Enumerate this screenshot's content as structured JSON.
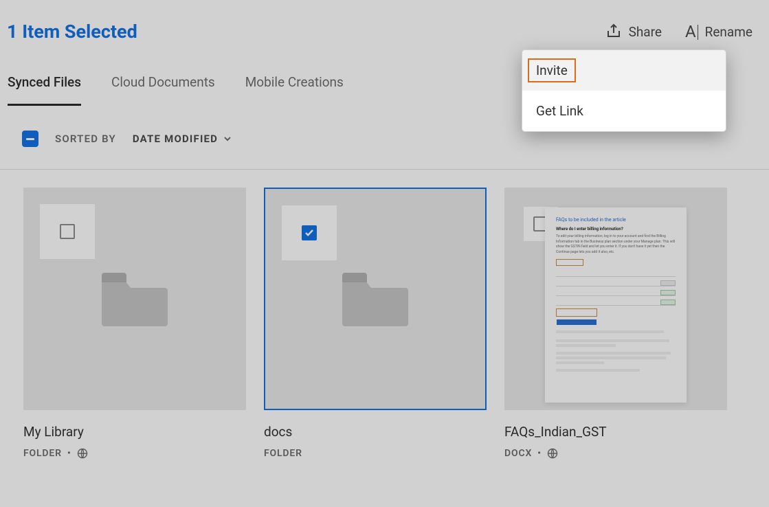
{
  "header": {
    "selection_title": "1 Item Selected",
    "share_label": "Share",
    "rename_label": "Rename"
  },
  "tabs": [
    {
      "label": "Synced Files",
      "active": true
    },
    {
      "label": "Cloud Documents",
      "active": false
    },
    {
      "label": "Mobile Creations",
      "active": false
    }
  ],
  "sort": {
    "label": "SORTED BY",
    "value": "DATE MODIFIED"
  },
  "items": [
    {
      "name": "My Library",
      "type_label": "FOLDER",
      "shared": true,
      "selected": false,
      "kind": "folder"
    },
    {
      "name": "docs",
      "type_label": "FOLDER",
      "shared": false,
      "selected": true,
      "kind": "folder"
    },
    {
      "name": "FAQs_Indian_GST",
      "type_label": "DOCX",
      "shared": true,
      "selected": false,
      "kind": "docx"
    }
  ],
  "dropdown": {
    "items": [
      {
        "label": "Invite",
        "highlighted": true
      },
      {
        "label": "Get Link",
        "highlighted": false
      }
    ]
  },
  "doc_preview": {
    "title": "FAQs to be included in the article"
  }
}
